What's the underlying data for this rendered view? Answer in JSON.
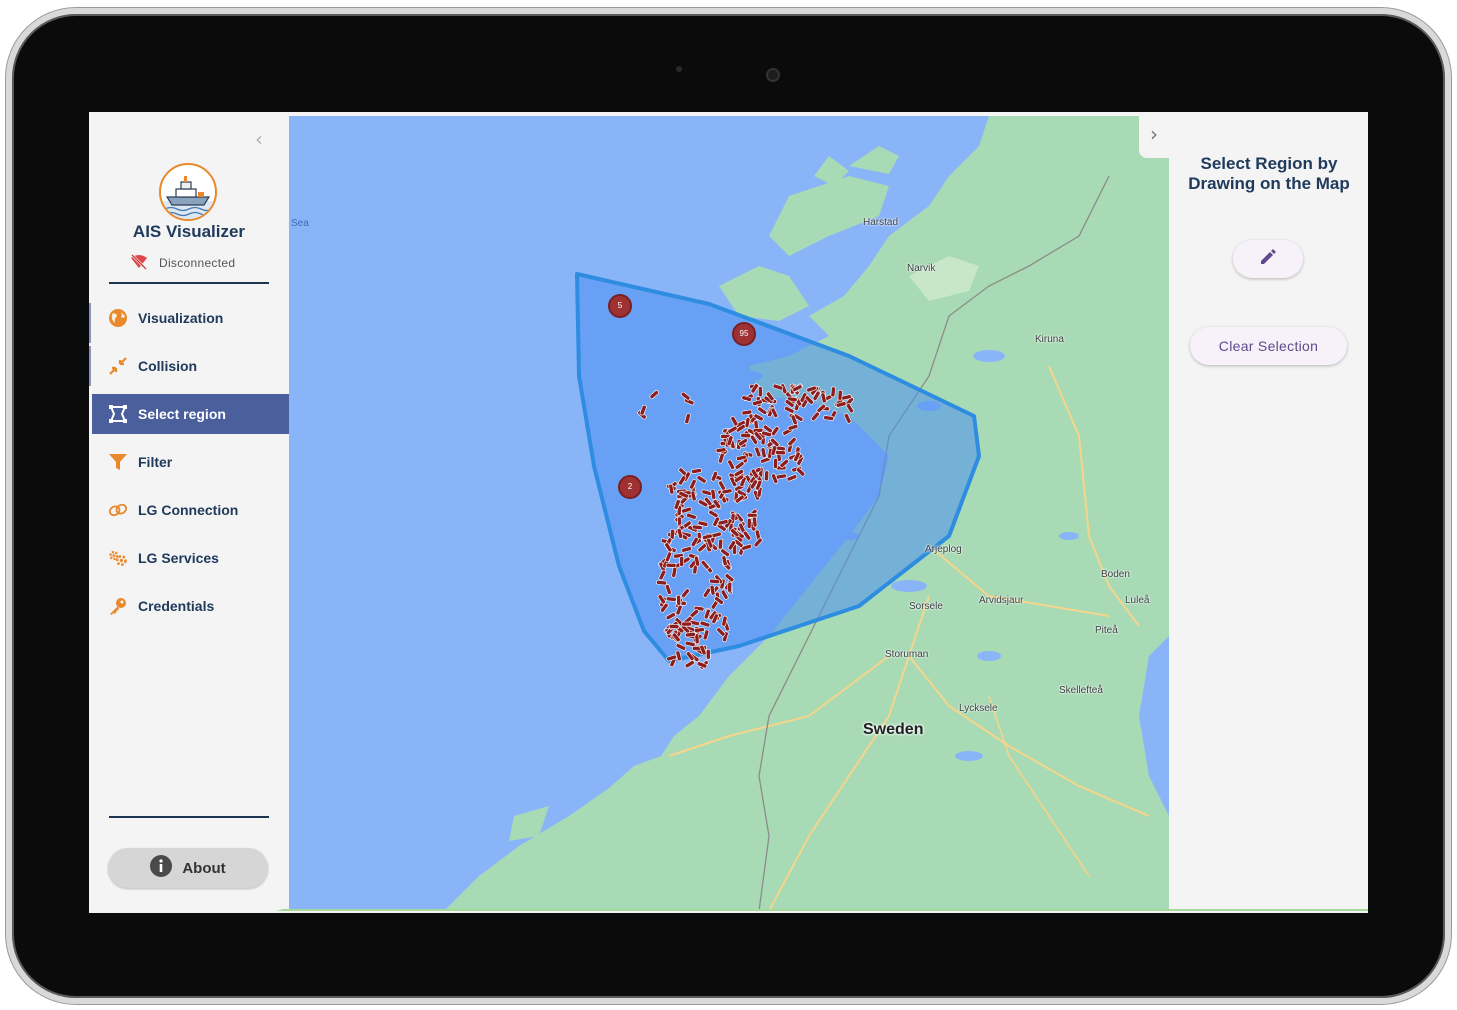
{
  "app": {
    "title": "AIS Visualizer",
    "connection_status": "Disconnected"
  },
  "sidebar": {
    "items": [
      {
        "label": "Visualization",
        "icon": "globe-icon"
      },
      {
        "label": "Collision",
        "icon": "collision-arrows-icon"
      },
      {
        "label": "Select region",
        "icon": "select-region-icon",
        "active": true
      },
      {
        "label": "Filter",
        "icon": "filter-funnel-icon"
      },
      {
        "label": "LG Connection",
        "icon": "link-icon"
      },
      {
        "label": "LG Services",
        "icon": "gears-icon"
      },
      {
        "label": "Credentials",
        "icon": "key-icon"
      }
    ],
    "about_label": "About"
  },
  "map": {
    "country_label": "Sweden",
    "sea_label": "Sea",
    "places": [
      "Harstad",
      "Narvik",
      "Kiruna",
      "Arjeplog",
      "Boden",
      "Luleå",
      "Sorsele",
      "Arvidsjaur",
      "Piteå",
      "Storuman",
      "Skellefteå",
      "Lycksele"
    ],
    "clusters": [
      "5",
      "95",
      "2"
    ]
  },
  "right_panel": {
    "title": "Select Region by Drawing on the Map",
    "draw_button_icon": "pencil-icon",
    "clear_label": "Clear Selection"
  },
  "colors": {
    "accent": "#4a5f9c",
    "heading": "#203a5c",
    "icon_orange": "#e8892c",
    "selection_fill": "#4a90f0",
    "ship_marker": "#8b1e1e",
    "water": "#8ab4f8",
    "land": "#a8dab5"
  }
}
